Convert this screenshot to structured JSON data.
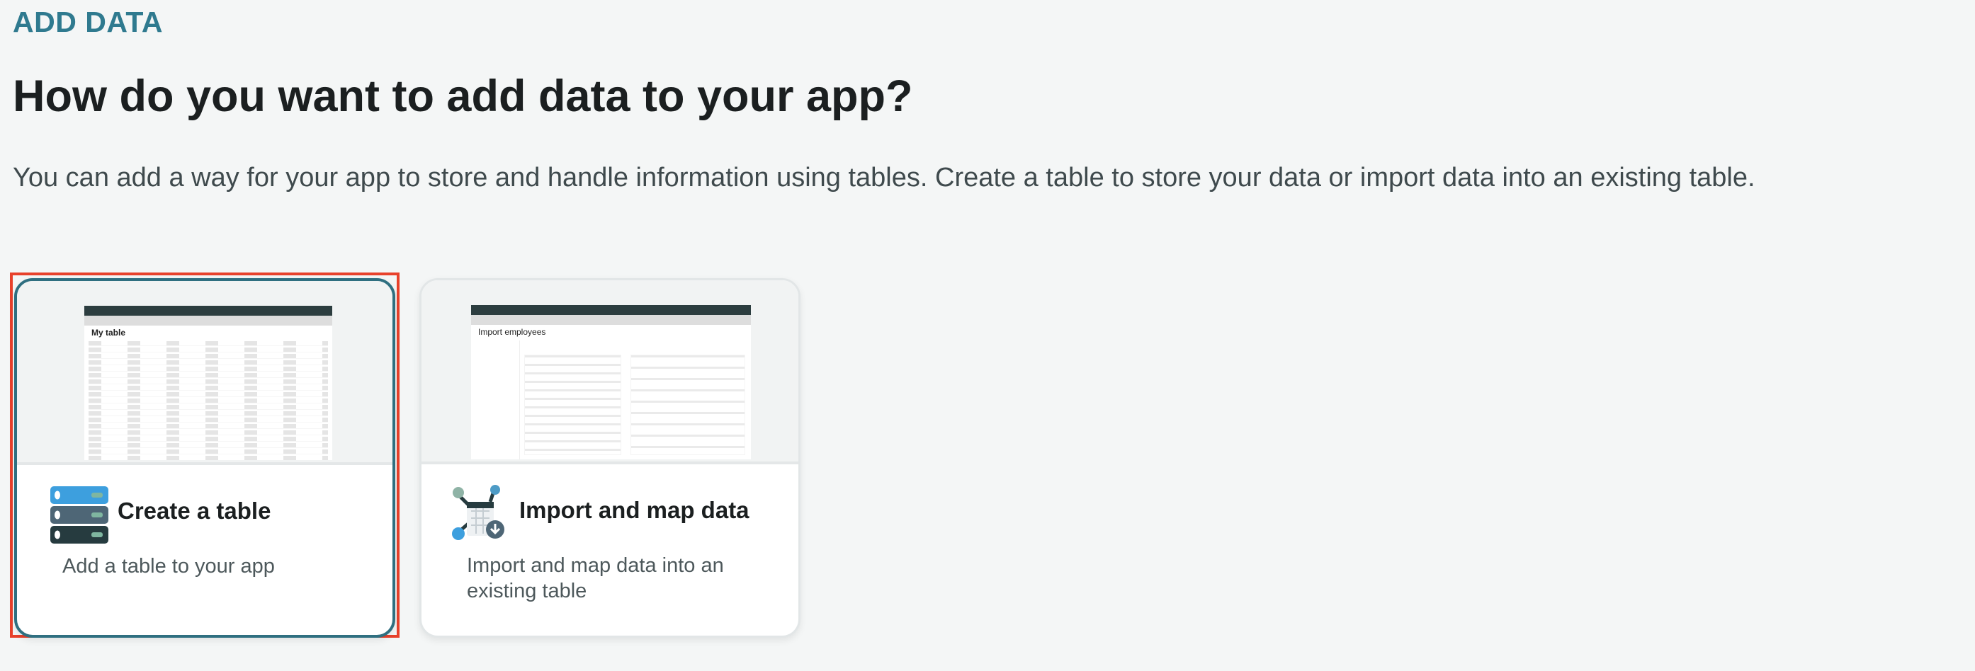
{
  "header": {
    "eyebrow": "ADD DATA",
    "title": "How do you want to add data to your app?",
    "description": "You can add a way for your app to store and handle information using tables. Create a table to store your data or import data into an existing table."
  },
  "cards": [
    {
      "title": "Create a table",
      "description": "Add a table to your app",
      "preview_heading": "My table",
      "icon": "database-stack-icon",
      "selected": true
    },
    {
      "title": "Import and map data",
      "description": "Import and map data into an existing table",
      "preview_heading": "Import employees",
      "icon": "import-table-icon",
      "selected": false
    }
  ],
  "colors": {
    "accent": "#2f7a8f",
    "focus_outline": "#e8412b",
    "selected_border": "#2f6f80"
  }
}
